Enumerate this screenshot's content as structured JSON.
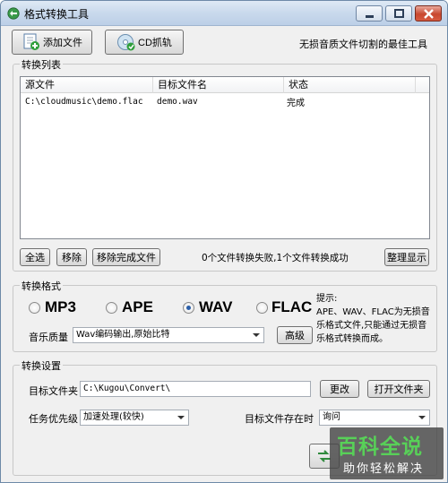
{
  "window": {
    "title": "格式转换工具"
  },
  "toolbar": {
    "add_file_label": "添加文件",
    "cd_rip_label": "CD抓轨",
    "slogan": "无损音质文件切割的最佳工具"
  },
  "conversion_list": {
    "section_label": "转换列表",
    "columns": [
      "源文件",
      "目标文件名",
      "状态"
    ],
    "rows": [
      {
        "source": "C:\\cloudmusic\\demo.flac",
        "target": "demo.wav",
        "status": "完成"
      }
    ]
  },
  "list_actions": {
    "select_all": "全选",
    "remove": "移除",
    "remove_completed": "移除完成文件",
    "result_text": "0个文件转换失败,1个文件转换成功",
    "tidy_display": "整理显示"
  },
  "format": {
    "section_label": "转换格式",
    "options": [
      "MP3",
      "APE",
      "WAV",
      "FLAC"
    ],
    "selected": "WAV",
    "hint": "提示:\nAPE、WAV、FLAC为无损音乐格式文件,只能通过无损音乐格式转换而成。",
    "quality_label": "音乐质量",
    "quality_value": "Wav编码输出,原始比特",
    "advanced_label": "高级"
  },
  "settings": {
    "section_label": "转换设置",
    "target_folder_label": "目标文件夹",
    "target_folder_value": "C:\\Kugou\\Convert\\",
    "change_label": "更改",
    "open_folder_label": "打开文件夹",
    "priority_label": "任务优先级",
    "priority_value": "加速处理(较快)",
    "exists_label": "目标文件存在时",
    "exists_value": "询问"
  },
  "watermark": {
    "main": "百科全说",
    "sub": "助你轻松解决"
  },
  "colors": {
    "title_gradient_top": "#dfe9f5",
    "close_red": "#c8472f",
    "radio_dot": "#2a5ea8",
    "watermark_green": "#58d058"
  }
}
